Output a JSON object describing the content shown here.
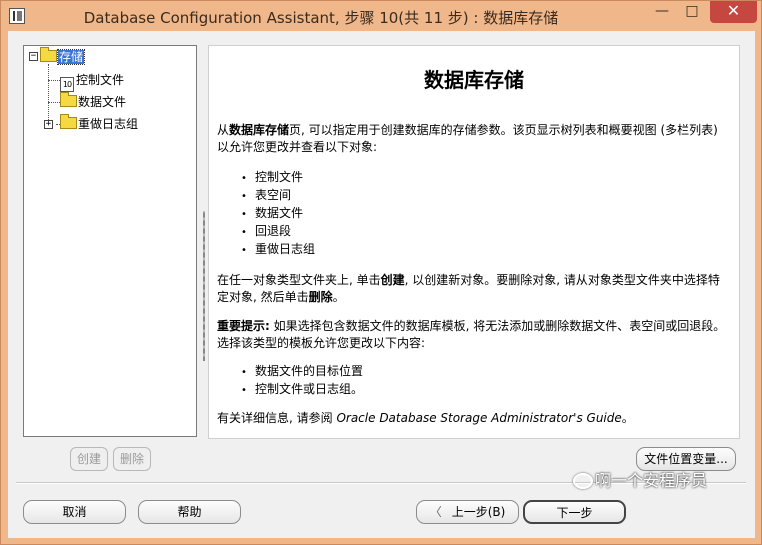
{
  "window": {
    "title": "Database Configuration Assistant, 步骤 10(共 11 步) : 数据库存储",
    "min_glyph": "—",
    "max_glyph": "□",
    "close_glyph": "✕"
  },
  "tree": {
    "root_expander": "−",
    "root_label": "存储",
    "items": [
      {
        "label": "控制文件",
        "icon": "control-file-icon",
        "icon_text": "10"
      },
      {
        "label": "数据文件",
        "icon": "folder-icon"
      },
      {
        "label": "重做日志组",
        "icon": "folder-icon",
        "expander": "+"
      }
    ]
  },
  "content": {
    "title": "数据库存储",
    "intro_prefix": "从",
    "intro_bold": "数据库存储",
    "intro_rest": "页, 可以指定用于创建数据库的存储参数。该页显示树列表和概要视图 (多栏列表) 以允许您更改并查看以下对象:",
    "objects": [
      "控制文件",
      "表空间",
      "数据文件",
      "回退段",
      "重做日志组"
    ],
    "create_text_1": "在任一对象类型文件夹上, 单击",
    "create_bold": "创建",
    "create_text_2": ", 以创建新对象。要删除对象, 请从对象类型文件夹中选择特定对象, 然后单击",
    "delete_bold": "删除",
    "create_text_3": "。",
    "important_bold": "重要提示:",
    "important_text": " 如果选择包含数据文件的数据库模板, 将无法添加或删除数据文件、表空间或回退段。选择该类型的模板允许您更改以下内容:",
    "changes": [
      "数据文件的目标位置",
      "控制文件或日志组。"
    ],
    "more_info_text": "有关详细信息, 请参阅 ",
    "guide_name": "Oracle Database Storage Administrator's Guide",
    "more_info_end": "。"
  },
  "buttons": {
    "create": "创建",
    "delete": "删除",
    "file_location_vars": "文件位置变量...",
    "cancel": "取消",
    "help": "帮助",
    "back": "上一步(B)",
    "back_icon": "〈",
    "next": "下一步"
  },
  "watermark": {
    "text": "啊一个安程序员"
  }
}
